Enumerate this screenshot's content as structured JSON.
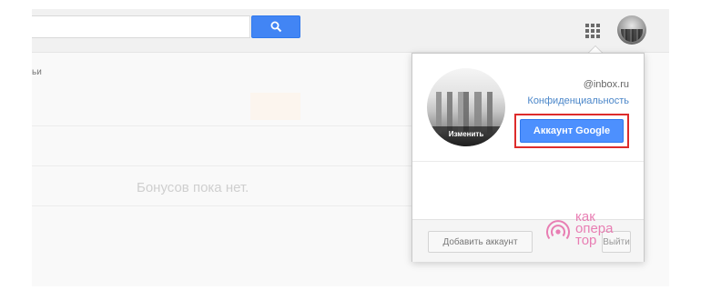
{
  "search": {
    "value": "",
    "button_icon": "search-icon"
  },
  "header": {
    "apps_icon": "apps-grid-icon",
    "avatar_icon": "account-avatar"
  },
  "page": {
    "section_label": "ьи",
    "empty_message": "Бонусов пока нет."
  },
  "account_popup": {
    "email": "@inbox.ru",
    "privacy_link": "Конфиденциальность",
    "google_account_button": "Аккаунт Google",
    "change_photo_label": "Изменить",
    "add_account_button": "Добавить аккаунт",
    "logout_button": "Выйти"
  },
  "watermark": {
    "lines": [
      "как",
      "опера",
      "тор"
    ],
    "icon": "signal-icon"
  },
  "colors": {
    "accent": "#4285f4",
    "highlight": "#dd2b2b",
    "watermark": "#e66aa8"
  }
}
